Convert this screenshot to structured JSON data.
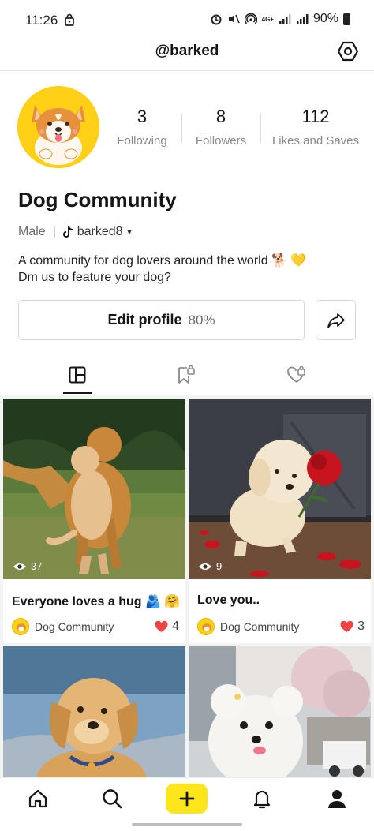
{
  "status_bar": {
    "time": "11:26",
    "network": "4G+",
    "battery": "90%"
  },
  "header": {
    "username": "@barked",
    "settings_icon": "hexagon-settings-icon"
  },
  "profile": {
    "display_name": "Dog Community",
    "gender": "Male",
    "tiktok_handle": "barked8",
    "bio": [
      "A community for dog lovers around the world 🐕 💛",
      "Dm us to feature your dog?"
    ],
    "stats": [
      {
        "value": "3",
        "label": "Following"
      },
      {
        "value": "8",
        "label": "Followers"
      },
      {
        "value": "112",
        "label": "Likes and Saves"
      }
    ]
  },
  "actions": {
    "edit_label": "Edit profile",
    "edit_completion": "80%",
    "share_icon": "share-arrow-icon"
  },
  "tabs": [
    {
      "icon": "grid-posts-icon",
      "selected": true
    },
    {
      "icon": "bookmark-lock-icon",
      "selected": false
    },
    {
      "icon": "heart-lock-icon",
      "selected": false
    }
  ],
  "posts": [
    {
      "title": "Everyone loves a hug 🫂 🤗",
      "views": "37",
      "author": "Dog Community",
      "likes": "4"
    },
    {
      "title": "Love you..",
      "views": "9",
      "author": "Dog Community",
      "likes": "3"
    },
    {
      "title": "",
      "views": "",
      "author": "",
      "likes": ""
    },
    {
      "title": "",
      "views": "",
      "author": "",
      "likes": ""
    }
  ],
  "bottom_nav": [
    {
      "icon": "home-icon"
    },
    {
      "icon": "search-icon"
    },
    {
      "icon": "plus-icon"
    },
    {
      "icon": "bell-icon"
    },
    {
      "icon": "profile-icon"
    }
  ],
  "colors": {
    "accent_yellow": "#ffe61c",
    "avatar_yellow": "#ffd016",
    "like_red": "#ee4444",
    "text_dark": "#161616",
    "text_muted": "#8a8a8a"
  }
}
